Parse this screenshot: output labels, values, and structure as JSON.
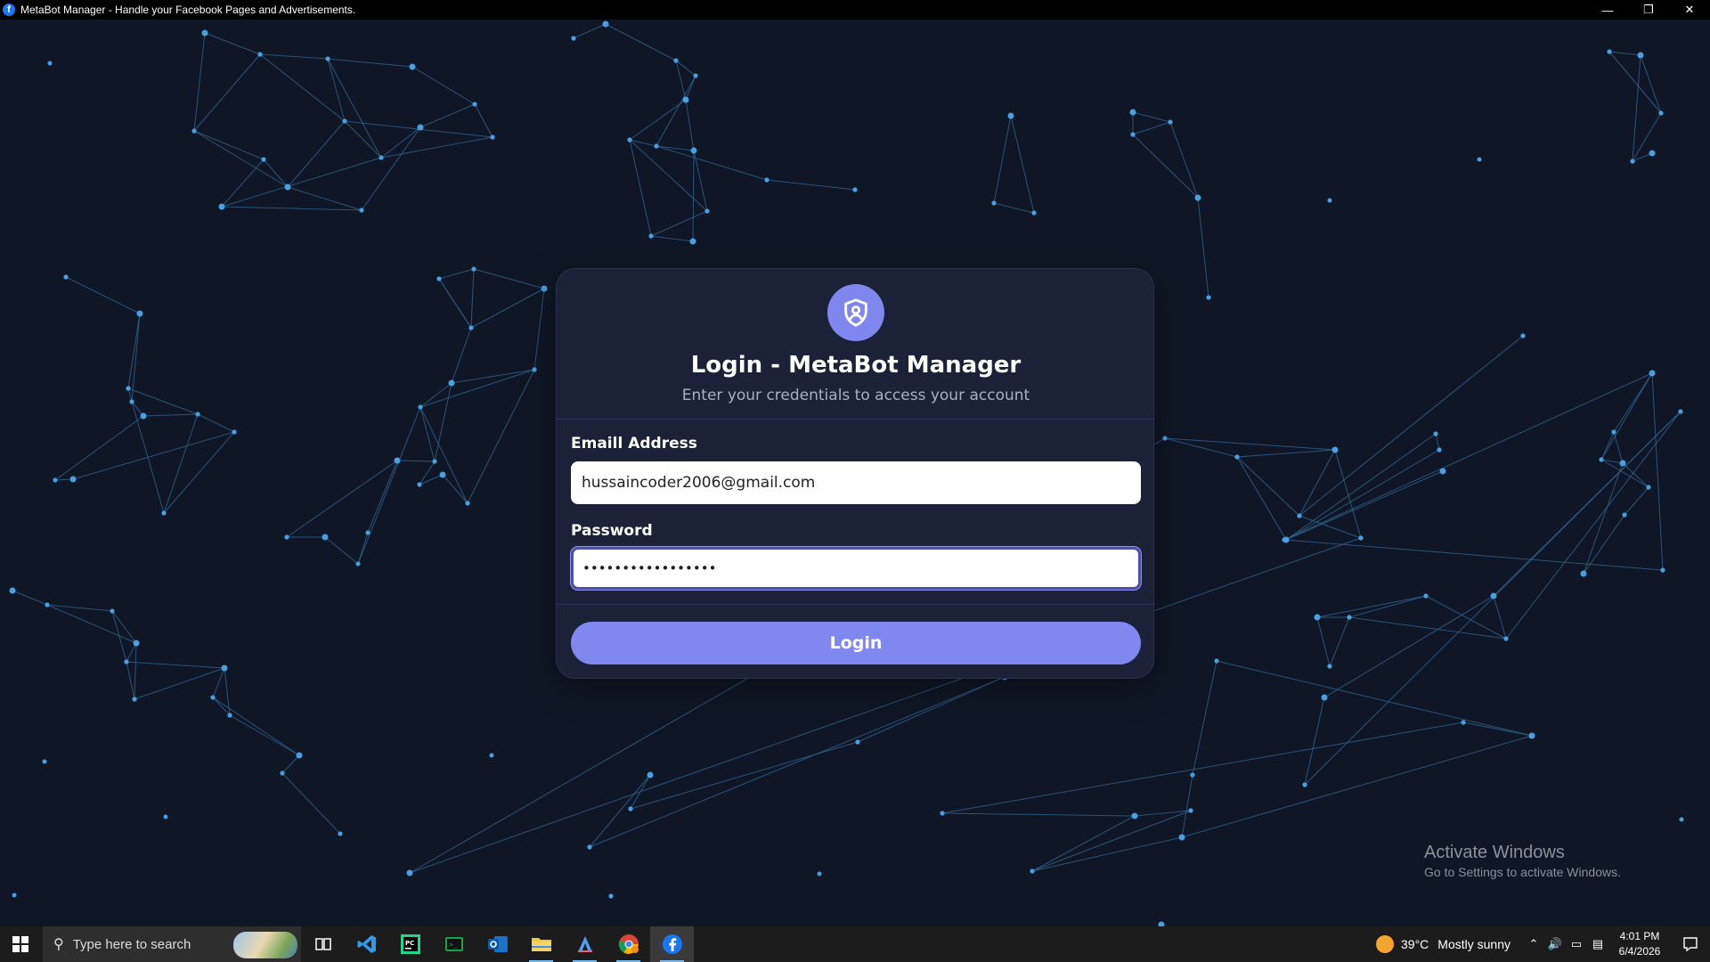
{
  "window": {
    "title": "MetaBot Manager - Handle your Facebook Pages and Advertisements.",
    "app_icon": "facebook-icon",
    "controls": [
      "minimize",
      "restore",
      "close"
    ]
  },
  "login": {
    "title": "Login - MetaBot Manager",
    "subtitle": "Enter your credentials to access your account",
    "email_label": "Emaill Address",
    "email_value": "hussaincoder2006@gmail.com",
    "password_label": "Password",
    "password_value": "•••••••••••••••••",
    "login_button": "Login",
    "icon": "shield-user-icon"
  },
  "watermark": {
    "line1": "Activate Windows",
    "line2": "Go to Settings to activate Windows."
  },
  "taskbar": {
    "search_placeholder": "Type here to search",
    "apps": [
      "task-view",
      "vscode",
      "pycharm",
      "terminal",
      "outlook",
      "file-explorer",
      "arc",
      "chrome",
      "facebook"
    ],
    "weather_temp": "39°C",
    "weather_desc": "Mostly sunny",
    "time": "4:01 PM",
    "date": "6/4/2026"
  },
  "colors": {
    "background": "#0f1726",
    "card": "#1b2136",
    "accent": "#8088f0",
    "network_line": "#2f5f8a",
    "network_node": "#4a9fe0"
  }
}
